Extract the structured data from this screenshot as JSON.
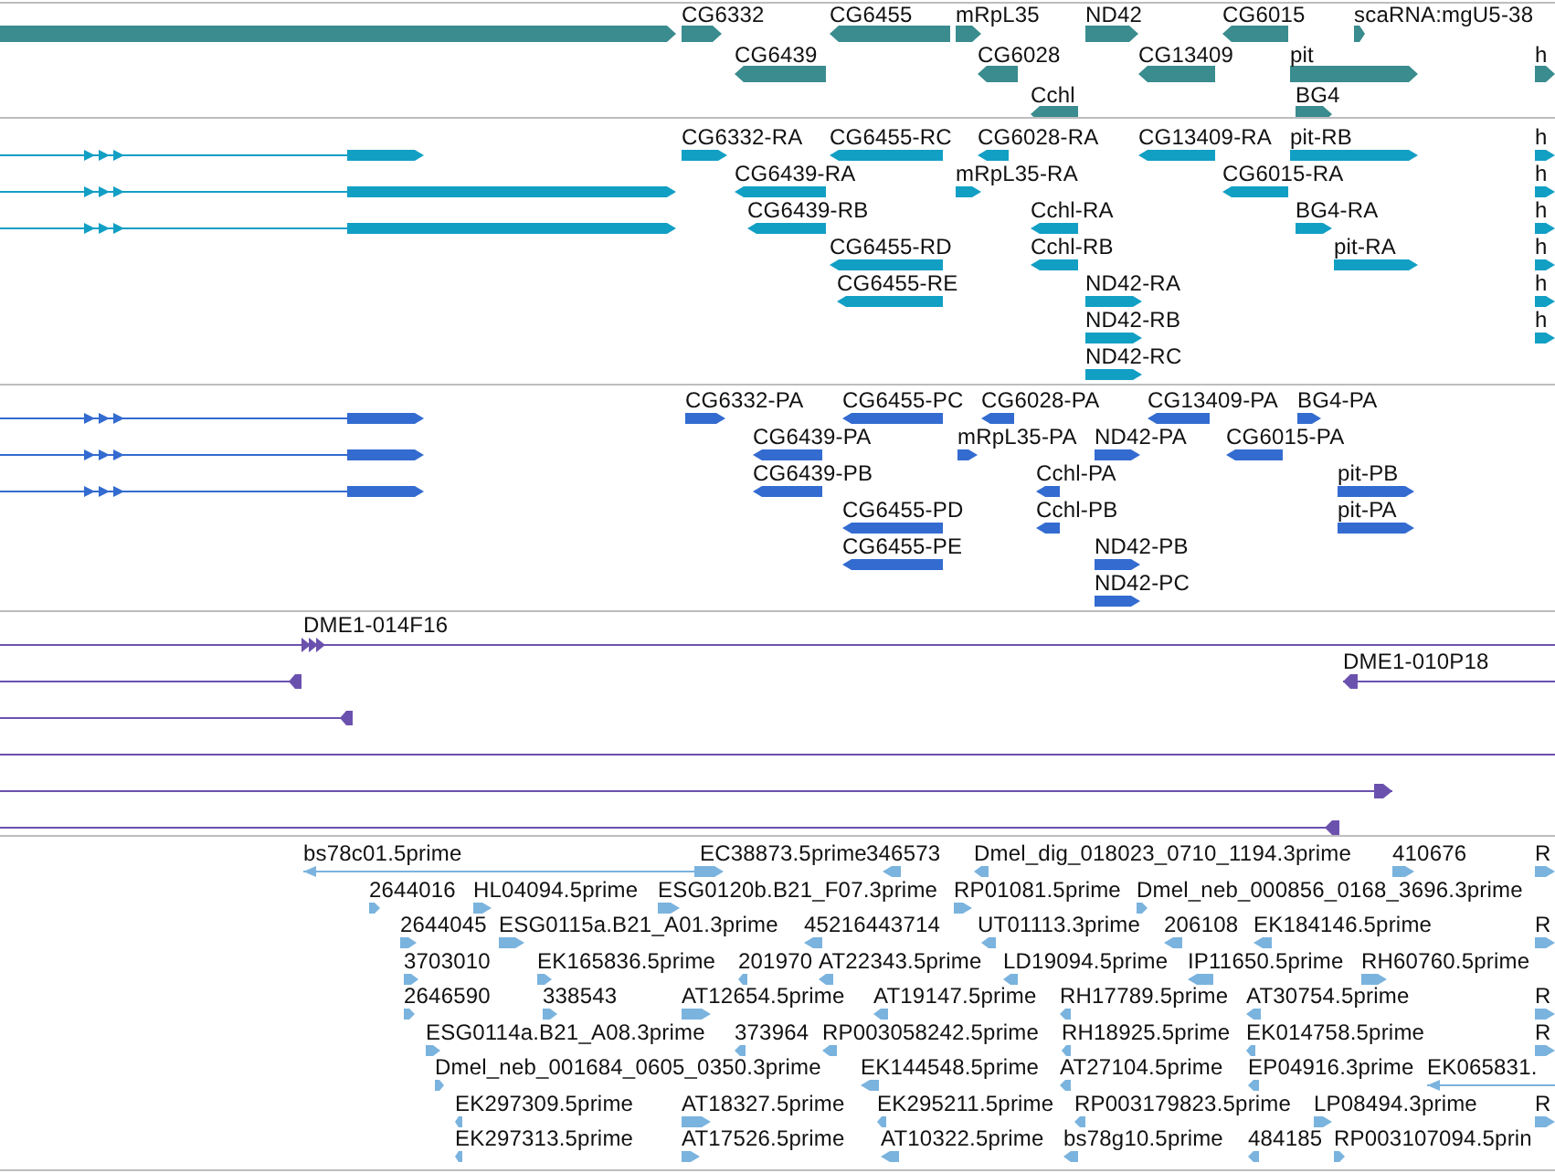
{
  "tracks": [
    {
      "kind": "genes",
      "features": [
        {
          "reverse": false
        },
        {
          "label": "CG6332",
          "reverse": false
        },
        {
          "label": "CG6455",
          "reverse": true
        },
        {
          "label": "mRpL35",
          "reverse": false
        },
        {
          "label": "ND42",
          "reverse": false
        },
        {
          "label": "CG6015",
          "reverse": true
        },
        {
          "label": "scaRNA:mgU5-38",
          "reverse": false
        },
        {
          "label": "CG6439",
          "reverse": true
        },
        {
          "label": "CG6028",
          "reverse": true
        },
        {
          "label": "CG13409",
          "reverse": true
        },
        {
          "label": "pit",
          "reverse": false
        },
        {
          "label": "h",
          "reverse": false
        },
        {
          "label": "Cchl",
          "reverse": true
        },
        {
          "label": "BG4",
          "reverse": false
        }
      ]
    },
    {
      "kind": "transcripts",
      "features": [
        {
          "reverse": false
        },
        {
          "label": "CG6332-RA",
          "reverse": false
        },
        {
          "label": "CG6455-RC",
          "reverse": true
        },
        {
          "label": "CG6028-RA",
          "reverse": true
        },
        {
          "label": "CG13409-RA",
          "reverse": true
        },
        {
          "label": "pit-RB",
          "reverse": false
        },
        {
          "label": "h",
          "reverse": false
        },
        {
          "reverse": false
        },
        {
          "label": "CG6439-RA",
          "reverse": true
        },
        {
          "label": "mRpL35-RA",
          "reverse": false
        },
        {
          "label": "CG6015-RA",
          "reverse": true
        },
        {
          "label": "h",
          "reverse": false
        },
        {
          "reverse": false
        },
        {
          "label": "CG6439-RB",
          "reverse": true
        },
        {
          "label": "Cchl-RA",
          "reverse": true
        },
        {
          "label": "BG4-RA",
          "reverse": false
        },
        {
          "label": "h",
          "reverse": false
        },
        {
          "label": "CG6455-RD",
          "reverse": true
        },
        {
          "label": "Cchl-RB",
          "reverse": true
        },
        {
          "label": "pit-RA",
          "reverse": false
        },
        {
          "label": "h",
          "reverse": false
        },
        {
          "label": "CG6455-RE",
          "reverse": true
        },
        {
          "label": "ND42-RA",
          "reverse": false
        },
        {
          "label": "h",
          "reverse": false
        },
        {
          "label": "ND42-RB",
          "reverse": false
        },
        {
          "label": "h",
          "reverse": false
        },
        {
          "label": "ND42-RC",
          "reverse": false
        }
      ]
    },
    {
      "kind": "proteins",
      "features": [
        {
          "reverse": false
        },
        {
          "label": "CG6332-PA",
          "reverse": false
        },
        {
          "label": "CG6455-PC",
          "reverse": true
        },
        {
          "label": "CG6028-PA",
          "reverse": true
        },
        {
          "label": "CG13409-PA",
          "reverse": true
        },
        {
          "label": "BG4-PA",
          "reverse": false
        },
        {
          "reverse": false
        },
        {
          "label": "CG6439-PA",
          "reverse": true
        },
        {
          "label": "mRpL35-PA",
          "reverse": false
        },
        {
          "label": "ND42-PA",
          "reverse": false
        },
        {
          "label": "CG6015-PA",
          "reverse": true
        },
        {
          "reverse": false
        },
        {
          "label": "CG6439-PB",
          "reverse": true
        },
        {
          "label": "Cchl-PA",
          "reverse": true
        },
        {
          "label": "pit-PB",
          "reverse": false
        },
        {
          "label": "CG6455-PD",
          "reverse": true
        },
        {
          "label": "Cchl-PB",
          "reverse": true
        },
        {
          "label": "pit-PA",
          "reverse": false
        },
        {
          "label": "CG6455-PE",
          "reverse": true
        },
        {
          "label": "ND42-PB",
          "reverse": false
        },
        {
          "label": "ND42-PC",
          "reverse": false
        }
      ]
    },
    {
      "kind": "clones",
      "features": [
        {
          "kind": "clone",
          "label": "DME1-014F16",
          "reverse": false
        },
        {
          "kind": "clone",
          "reverse": true
        },
        {
          "kind": "clone",
          "label": "DME1-010P18",
          "reverse": true
        },
        {
          "kind": "clone",
          "reverse": true
        },
        {
          "kind": "span"
        },
        {
          "kind": "clone",
          "reverse": false
        },
        {
          "kind": "clone",
          "reverse": true
        }
      ]
    },
    {
      "kind": "ests",
      "features": [
        {
          "label": "bs78c01.5prime",
          "reverse": true
        },
        {
          "label": "EC38873.5prime",
          "reverse": false
        },
        {
          "label": "346573",
          "reverse": true
        },
        {
          "label": "Dmel_dig_018023_0710_1194.3prime",
          "reverse": true
        },
        {
          "label": "410676",
          "reverse": false
        },
        {
          "label": "R",
          "reverse": false
        },
        {
          "label": "2644016",
          "reverse": false
        },
        {
          "label": "HL04094.5prime",
          "reverse": false
        },
        {
          "label": "ESG0120b.B21_F07.3prime",
          "reverse": false
        },
        {
          "label": "RP01081.5prime",
          "reverse": false
        },
        {
          "label": "Dmel_neb_000856_0168_3696.3prime",
          "reverse": false
        },
        {
          "label": "2644045",
          "reverse": false
        },
        {
          "label": "ESG0115a.B21_A01.3prime",
          "reverse": false
        },
        {
          "label": "45216443714",
          "reverse": true
        },
        {
          "label": "UT01113.3prime",
          "reverse": true
        },
        {
          "label": "206108",
          "reverse": true
        },
        {
          "label": "EK184146.5prime",
          "reverse": true
        },
        {
          "label": "R",
          "reverse": false
        },
        {
          "label": "3703010",
          "reverse": false
        },
        {
          "label": "EK165836.5prime",
          "reverse": false
        },
        {
          "label": "201970",
          "reverse": true
        },
        {
          "label": "AT22343.5prime",
          "reverse": true
        },
        {
          "label": "LD19094.5prime",
          "reverse": true
        },
        {
          "label": "IP11650.5prime",
          "reverse": true
        },
        {
          "label": "RH60760.5prime",
          "reverse": false
        },
        {
          "label": "2646590",
          "reverse": false
        },
        {
          "label": "338543",
          "reverse": false
        },
        {
          "label": "AT12654.5prime",
          "reverse": false
        },
        {
          "label": "AT19147.5prime",
          "reverse": true
        },
        {
          "label": "RH17789.5prime",
          "reverse": true
        },
        {
          "label": "AT30754.5prime",
          "reverse": true
        },
        {
          "label": "R",
          "reverse": false
        },
        {
          "label": "ESG0114a.B21_A08.3prime",
          "reverse": false
        },
        {
          "label": "373964",
          "reverse": true
        },
        {
          "label": "RP003058242.5prime",
          "reverse": true
        },
        {
          "label": "RH18925.5prime",
          "reverse": true
        },
        {
          "label": "EK014758.5prime",
          "reverse": true
        },
        {
          "label": "R",
          "reverse": false
        },
        {
          "label": "Dmel_neb_001684_0605_0350.3prime",
          "reverse": false
        },
        {
          "label": "EK144548.5prime",
          "reverse": true
        },
        {
          "label": "AT27104.5prime",
          "reverse": true
        },
        {
          "label": "EP04916.3prime",
          "reverse": true
        },
        {
          "label": "EK065831.",
          "reverse": true
        },
        {
          "label": "EK297309.5prime",
          "reverse": true
        },
        {
          "label": "AT18327.5prime",
          "reverse": false
        },
        {
          "label": "EK295211.5prime",
          "reverse": true
        },
        {
          "label": "RP003179823.5prime",
          "reverse": true
        },
        {
          "label": "LP08494.3prime",
          "reverse": false
        },
        {
          "label": "R",
          "reverse": false
        },
        {
          "label": "EK297313.5prime",
          "reverse": true
        },
        {
          "label": "AT17526.5prime",
          "reverse": false
        },
        {
          "label": "AT10322.5prime",
          "reverse": true
        },
        {
          "label": "bs78g10.5prime",
          "reverse": true
        },
        {
          "label": "484185",
          "reverse": true
        },
        {
          "label": "RP003107094.5prin",
          "reverse": false
        }
      ]
    }
  ]
}
